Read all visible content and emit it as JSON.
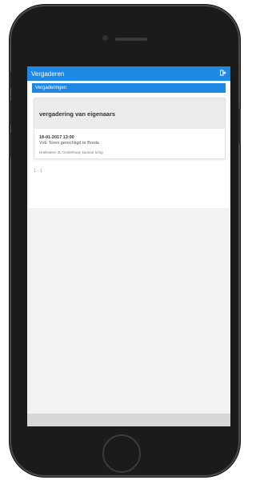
{
  "app": {
    "title": "Vergaderen",
    "exit_icon": "logout-icon"
  },
  "section": {
    "title": "Vergaderingen"
  },
  "meeting": {
    "title": "vergadering van eigenaars",
    "datetime": "18-01-2017 13:00",
    "subtitle": "VvE Toren gerechtigd te Breda",
    "location": "Hoeksteen 3L Oosterhout, kantoor kring"
  },
  "pagination": {
    "text": "1 - 1"
  },
  "colors": {
    "accent": "#1e88e5",
    "card_header": "#ececec",
    "footer": "#d7d7d7"
  }
}
